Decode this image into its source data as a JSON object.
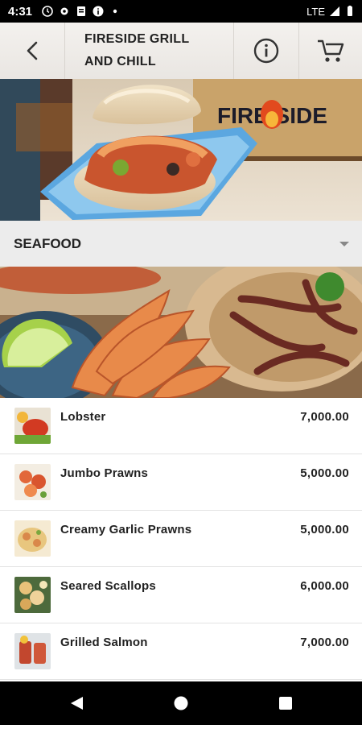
{
  "status_bar": {
    "time": "4:31",
    "network": "LTE"
  },
  "header": {
    "title_line1": "FIRESIDE GRILL",
    "title_line2": "AND CHILL"
  },
  "hero": {
    "sign_text": "FIRE SIDE"
  },
  "category": {
    "label": "SEAFOOD"
  },
  "menu": {
    "items": [
      {
        "name": "Lobster",
        "price": "7,000.00"
      },
      {
        "name": "Jumbo Prawns",
        "price": "5,000.00"
      },
      {
        "name": "Creamy Garlic Prawns",
        "price": "5,000.00"
      },
      {
        "name": "Seared Scallops",
        "price": "6,000.00"
      },
      {
        "name": "Grilled Salmon",
        "price": "7,000.00"
      }
    ]
  },
  "colors": {
    "header_bg": "#f1eeea",
    "category_bg": "#ececec",
    "plate_blue": "#5ba7e0",
    "sign_wood": "#c9a36a"
  },
  "icons": [
    "back-icon",
    "info-icon",
    "cart-icon",
    "chevron-down-icon"
  ]
}
